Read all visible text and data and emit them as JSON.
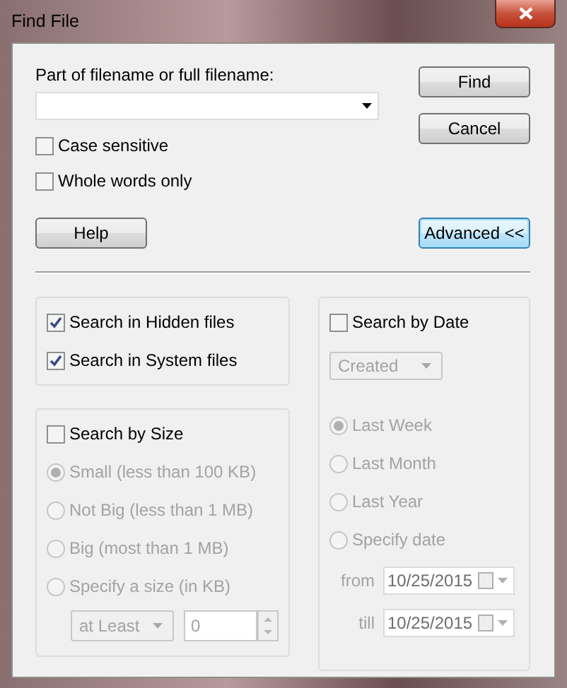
{
  "window": {
    "title": "Find File"
  },
  "filename": {
    "label": "Part of filename or full filename:"
  },
  "options": [
    {
      "label": "Case sensitive",
      "checked": false
    },
    {
      "label": "Whole words only",
      "checked": false
    }
  ],
  "buttons": [
    {
      "label": "Find",
      "kind": "top",
      "focused": false
    },
    {
      "label": "Cancel",
      "kind": "top",
      "focused": false
    },
    {
      "label": "Help",
      "kind": "left",
      "focused": false
    },
    {
      "label": "Advanced <<",
      "kind": "right",
      "focused": true
    }
  ],
  "attributes": [
    {
      "label": "Search in Hidden files",
      "checked": true
    },
    {
      "label": "Search in System files",
      "checked": true
    }
  ],
  "size": {
    "label": "Search by Size",
    "checked": false,
    "options": [
      {
        "label": "Small (less than 100 KB)",
        "selected": true
      },
      {
        "label": "Not Big (less than 1 MB)",
        "selected": false
      },
      {
        "label": "Big (most than 1 MB)",
        "selected": false
      },
      {
        "label": "Specify a size (in KB)",
        "selected": false
      }
    ],
    "mode": "at Least",
    "value": "0"
  },
  "date": {
    "label": "Search by Date",
    "checked": false,
    "field": "Created",
    "options": [
      {
        "label": "Last Week",
        "selected": true
      },
      {
        "label": "Last Month",
        "selected": false
      },
      {
        "label": "Last Year",
        "selected": false
      },
      {
        "label": "Specify date",
        "selected": false
      }
    ],
    "from": {
      "label": "from",
      "value": "10/25/2015"
    },
    "till": {
      "label": "till",
      "value": "10/25/2015"
    }
  }
}
